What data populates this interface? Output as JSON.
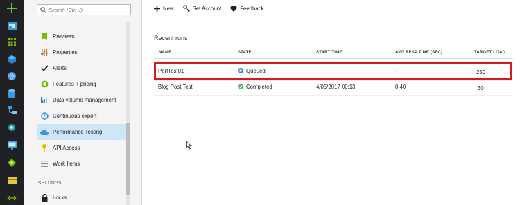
{
  "rail": {
    "icons": [
      "plus-icon",
      "dashboard-icon",
      "grid-icon",
      "cube-icon",
      "globe-icon",
      "database-icon",
      "network-icon",
      "app-service-icon",
      "monitor-icon",
      "puzzle-icon",
      "card-icon",
      "arrows-icon"
    ]
  },
  "search": {
    "placeholder": "Search (Ctrl+/)"
  },
  "menu": {
    "items": [
      {
        "label": "Previews"
      },
      {
        "label": "Properties"
      },
      {
        "label": "Alerts"
      },
      {
        "label": "Features + pricing"
      },
      {
        "label": "Data volume management"
      },
      {
        "label": "Continuous export"
      },
      {
        "label": "Performance Testing",
        "selected": true
      },
      {
        "label": "API Access"
      },
      {
        "label": "Work Items"
      }
    ],
    "settings_label": "SETTINGS",
    "locks_label": "Locks"
  },
  "toolbar": {
    "new_label": "New",
    "set_account_label": "Set Account",
    "feedback_label": "Feedback"
  },
  "runs": {
    "title": "Recent runs",
    "columns": [
      "NAME",
      "STATE",
      "START TIME",
      "AVG RESP TIME (SEC)",
      "TARGET LOAD"
    ],
    "rows": [
      {
        "name": "PerfTest01",
        "state": "Queued",
        "start_time": "",
        "avg_resp": "-",
        "target_load": "250"
      },
      {
        "name": "Blog Post Test",
        "state": "Completed",
        "start_time": "4/05/2017 00:13",
        "avg_resp": "0.40",
        "target_load": "30"
      }
    ]
  },
  "colors": {
    "rail_bg": "#1f2124",
    "accent_green": "#5cb85c",
    "selected_bg": "#cfe6f7",
    "highlight_red": "#d71920",
    "queued_blue": "#2f7fd1"
  }
}
